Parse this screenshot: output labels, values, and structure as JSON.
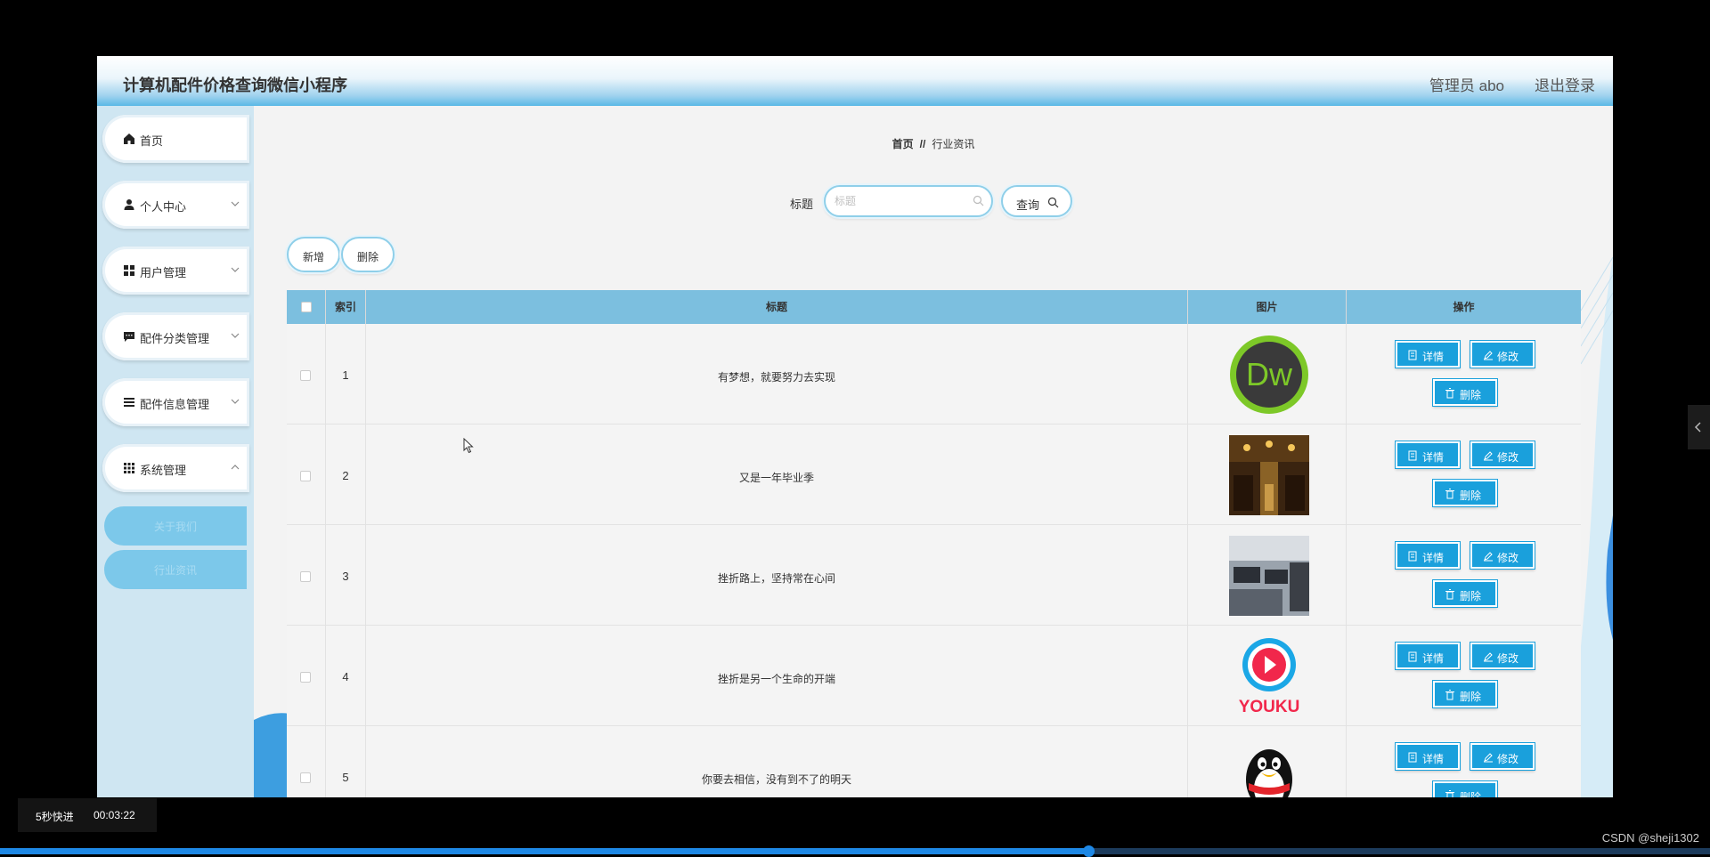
{
  "header": {
    "title": "计算机配件价格查询微信小程序",
    "admin": "管理员 abo",
    "logout": "退出登录"
  },
  "sidebar": {
    "items": [
      {
        "label": "首页",
        "icon": "home-icon"
      },
      {
        "label": "个人中心",
        "icon": "user-icon"
      },
      {
        "label": "用户管理",
        "icon": "grid-icon"
      },
      {
        "label": "配件分类管理",
        "icon": "chat-icon"
      },
      {
        "label": "配件信息管理",
        "icon": "list-icon"
      },
      {
        "label": "系统管理",
        "icon": "apps-icon"
      }
    ],
    "subitems": [
      {
        "label": "关于我们"
      },
      {
        "label": "行业资讯"
      }
    ]
  },
  "breadcrumb": {
    "home": "首页",
    "separator": "//",
    "current": "行业资讯"
  },
  "search": {
    "label": "标题",
    "placeholder": "标题",
    "button": "查询"
  },
  "toolbar": {
    "add": "新增",
    "delete": "删除"
  },
  "table": {
    "columns": [
      "索引",
      "标题",
      "图片",
      "操作"
    ],
    "rows": [
      {
        "index": "1",
        "title": "有梦想，就要努力去实现",
        "image": "dw-logo"
      },
      {
        "index": "2",
        "title": "又是一年毕业季",
        "image": "restaurant-photo"
      },
      {
        "index": "3",
        "title": "挫折路上，坚持常在心间",
        "image": "computer-room-photo"
      },
      {
        "index": "4",
        "title": "挫折是另一个生命的开端",
        "image": "youku-logo"
      },
      {
        "index": "5",
        "title": "你要去相信，没有到不了的明天",
        "image": "qq-penguin"
      }
    ],
    "actions": {
      "detail": "详情",
      "edit": "修改",
      "delete": "删除"
    }
  },
  "player": {
    "fast_forward": "5秒快进",
    "time": "00:03:22"
  },
  "watermark": "CSDN @sheji1302",
  "colors": {
    "accent": "#1aa0dc",
    "table_header": "#7cbfdf",
    "sidebar_bg": "#cfe6f2"
  }
}
